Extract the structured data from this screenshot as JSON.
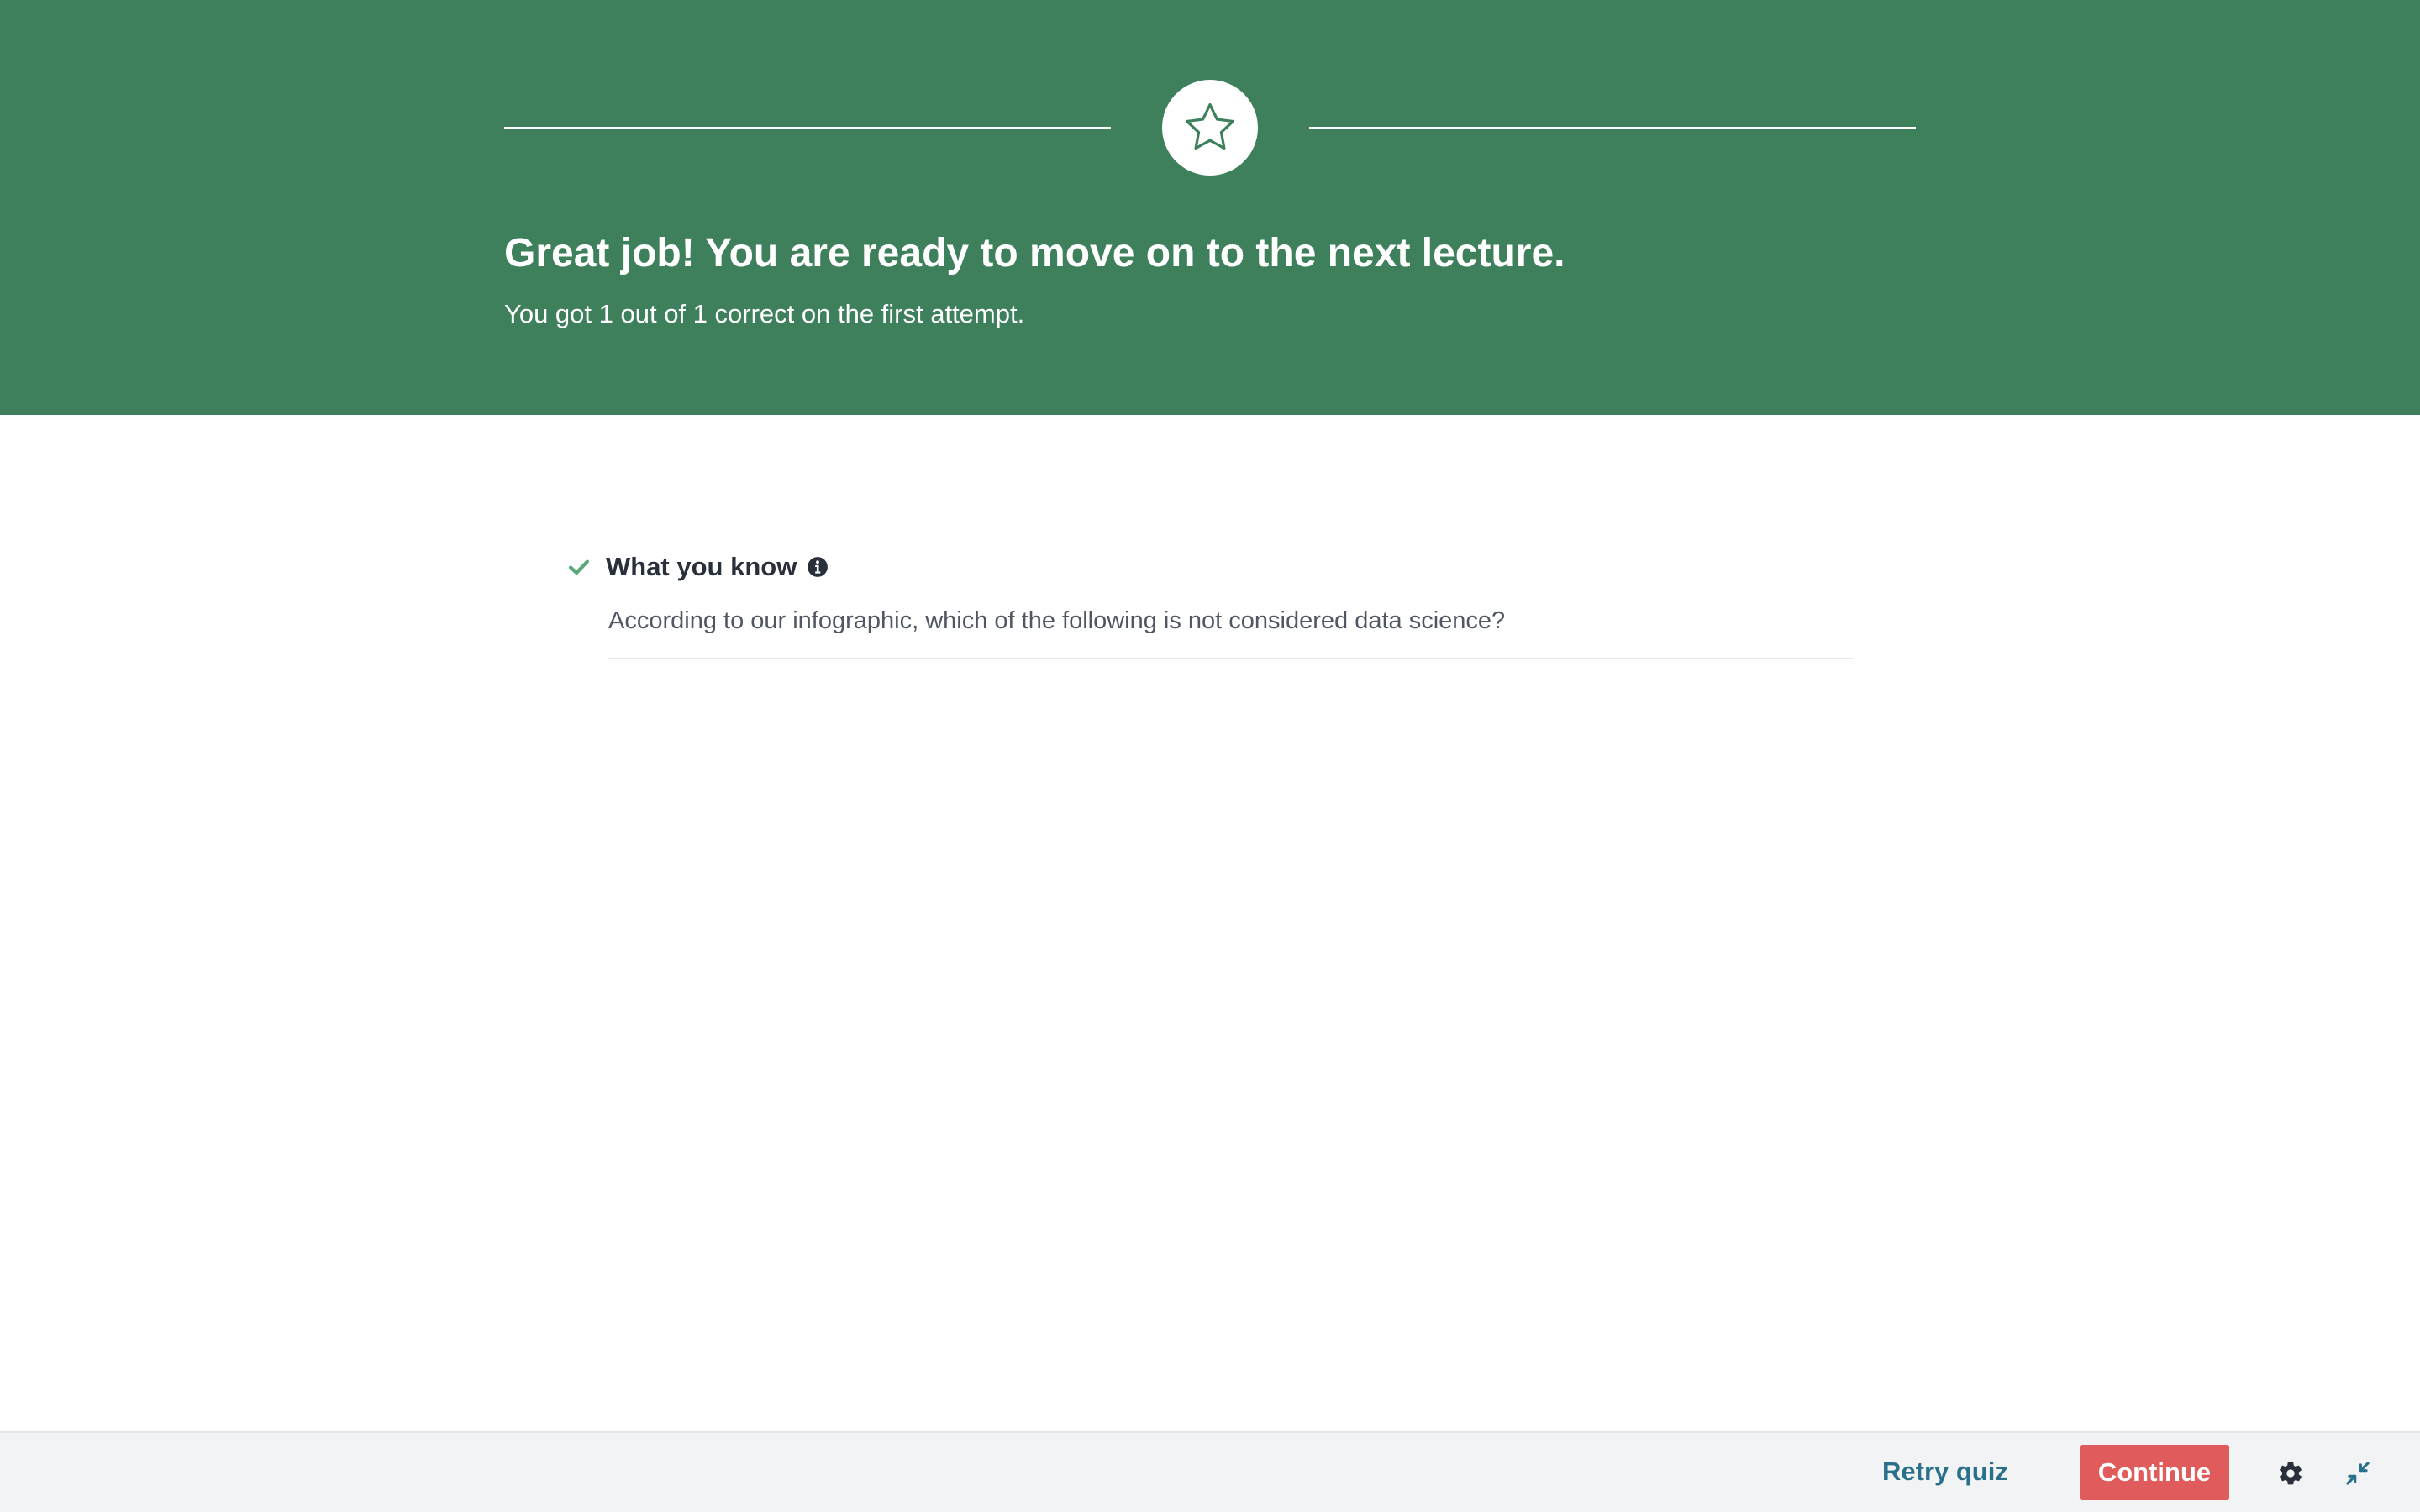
{
  "banner": {
    "title": "Great job! You are ready to move on to the next lecture.",
    "subtitle": "You got 1 out of 1 correct on the first attempt.",
    "icon": "star-icon",
    "background_color": "#3e805c"
  },
  "what_you_know": {
    "title": "What you know",
    "status_icon": "check-icon",
    "info_icon": "info-icon",
    "questions": [
      "According to our infographic, which of the following is not considered data science?"
    ]
  },
  "footer": {
    "retry_label": "Retry quiz",
    "continue_label": "Continue",
    "settings_icon": "gear-icon",
    "collapse_icon": "collapse-icon"
  },
  "colors": {
    "banner": "#3e805c",
    "accent": "#e05b5b",
    "link": "#29708a",
    "check": "#5aa97a"
  }
}
